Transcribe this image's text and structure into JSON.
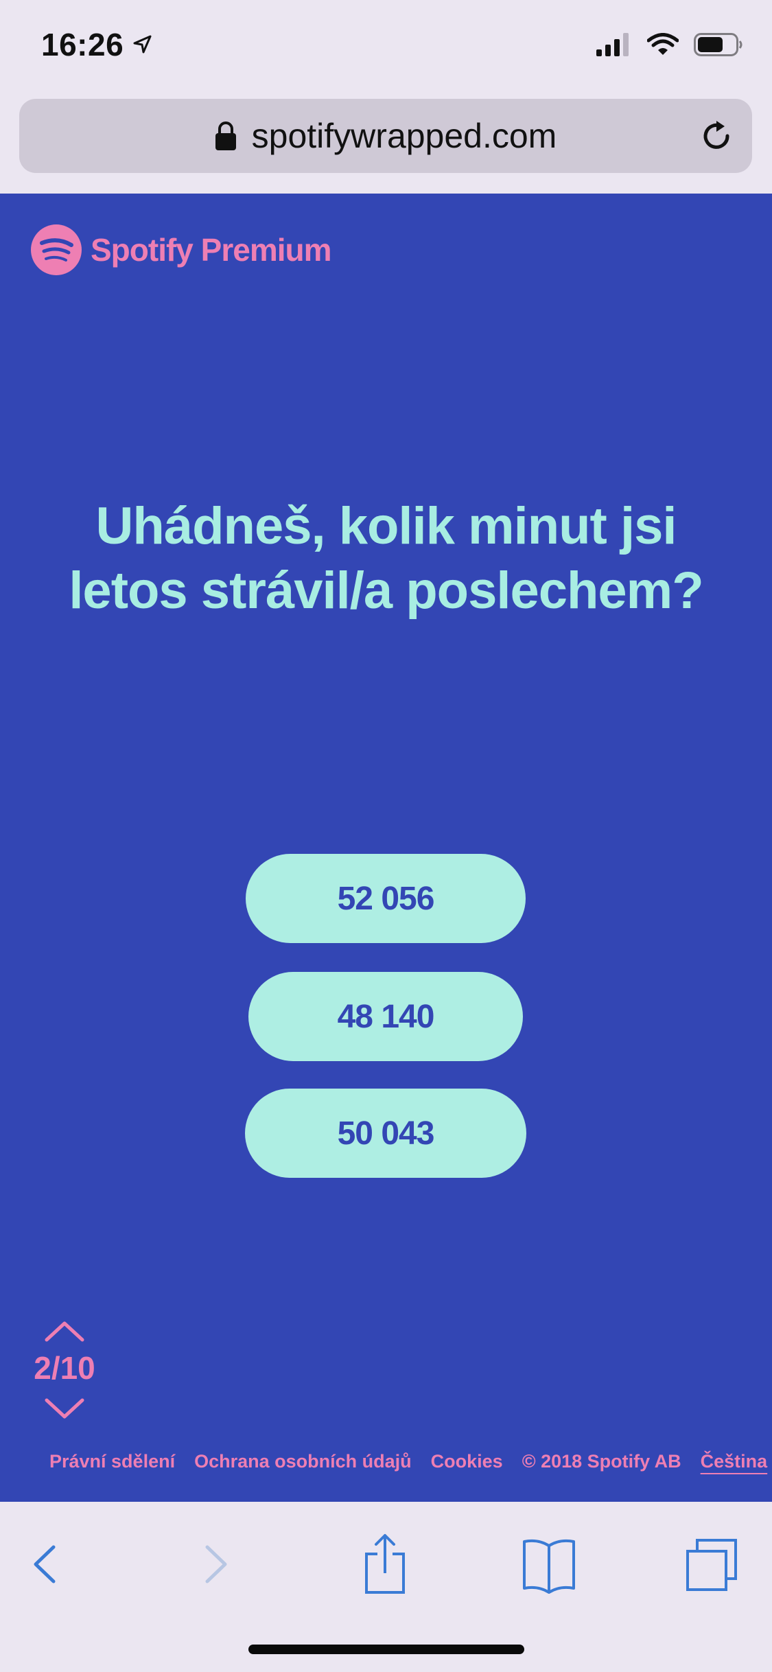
{
  "status_bar": {
    "time": "16:26",
    "icons": [
      "location-arrow-icon",
      "signal-icon",
      "wifi-icon",
      "battery-icon"
    ]
  },
  "browser": {
    "url": "spotifywrapped.com",
    "icons": [
      "lock-icon",
      "reload-icon"
    ]
  },
  "page": {
    "brand": "Spotify Premium",
    "question": "Uhádneš, kolik minut jsi letos strávil/a poslechem?",
    "answers": [
      "52 056",
      "48 140",
      "50 043"
    ],
    "pager": "2/10",
    "footer": {
      "legal": "Právní sdělení",
      "privacy": "Ochrana osobních údajů",
      "cookies": "Cookies",
      "copyright": "© 2018 Spotify AB",
      "language": "Čeština"
    }
  },
  "toolbar": {
    "icons": [
      "back-icon",
      "forward-icon",
      "share-icon",
      "bookmarks-icon",
      "tabs-icon"
    ]
  },
  "colors": {
    "page_background": "#3346b4",
    "accent_pink": "#ee7fb3",
    "mint": "#aeeee3",
    "ios_blue": "#3a7bd5"
  }
}
